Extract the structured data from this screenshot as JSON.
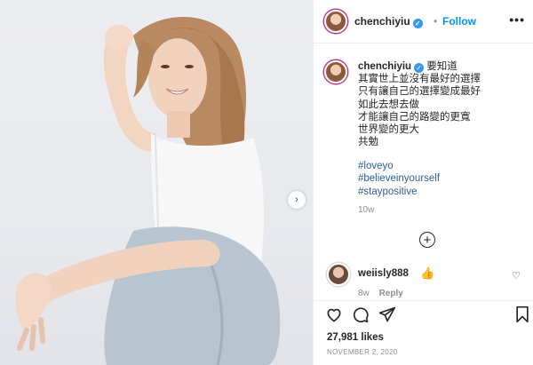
{
  "post": {
    "username": "chenchiyiu",
    "follow_label": "Follow",
    "more_label": "•••",
    "separator": "•",
    "caption_lines": [
      "要知道",
      "其實世上並沒有最好的選擇",
      "只有讓自己的選擇變成最好",
      "如此去想去做",
      "才能讓自己的路變的更寬",
      "世界變的更大",
      "共勉"
    ],
    "hashtags": [
      "#loveyo",
      "#believeinyourself",
      "#staypositive"
    ],
    "time_ago": "10w",
    "load_more_label": "+",
    "likes": "27,981 likes",
    "date": "NOVEMBER 2, 2020"
  },
  "comment": {
    "username": "weiisly888",
    "emoji": "👍",
    "time": "8w",
    "reply_label": "Reply"
  },
  "icons": {
    "verified": "verified-badge",
    "heart": "heart-icon",
    "comment": "comment-icon",
    "share": "share-icon",
    "save": "bookmark-icon",
    "next": "chevron-right-icon"
  },
  "colors": {
    "link": "#0095f6",
    "hashtag": "#2e5d9a",
    "muted": "#8e8e8e"
  }
}
